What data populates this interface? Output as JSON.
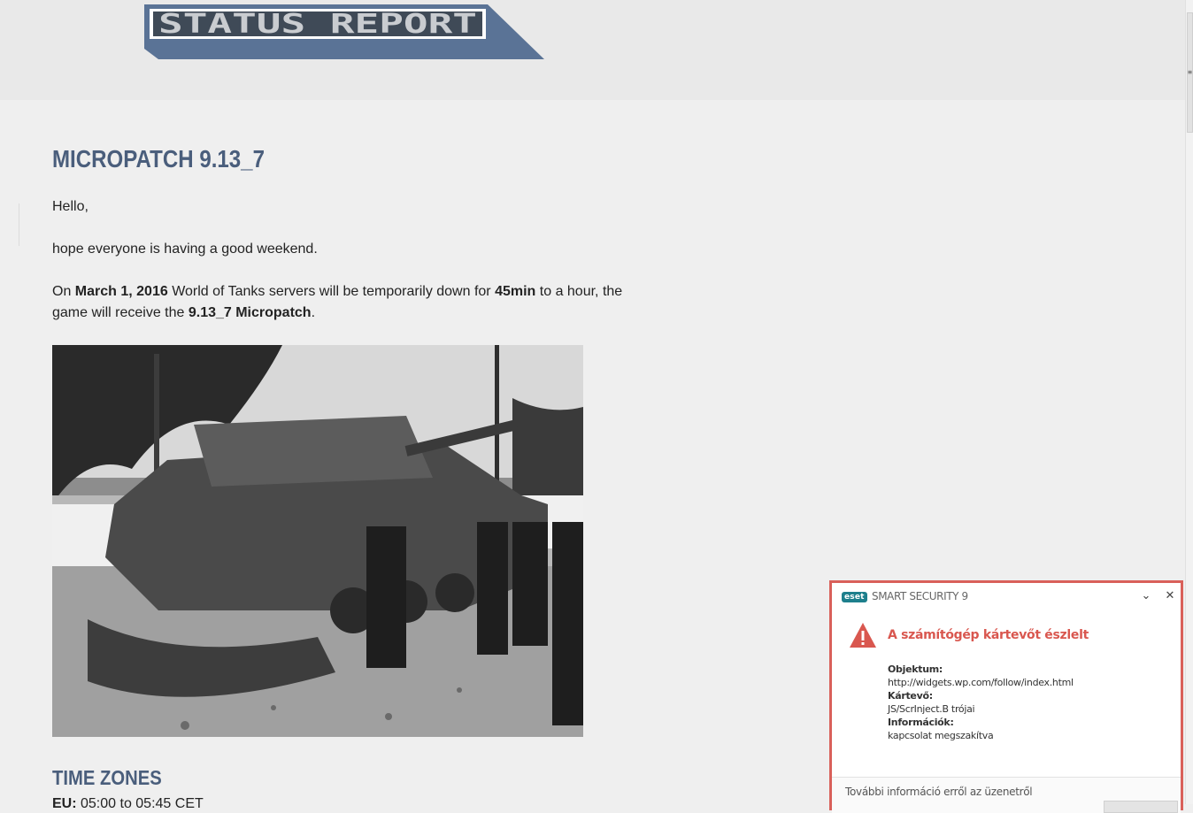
{
  "header": {
    "logo_text": "STATUS REPORT"
  },
  "article": {
    "title": "MICROPATCH 9.13_7",
    "greeting": "Hello,",
    "intro": "hope everyone is having a good weekend.",
    "body": {
      "p1": "On ",
      "date": "March 1, 2016",
      "p2": " World of Tanks servers will be temporarily down for ",
      "duration": "45min",
      "p3": " to a hour, the game will receive the ",
      "patch": "9.13_7 Micropatch",
      "p4": "."
    },
    "image_subject": "tank-photo",
    "section_title": "TIME ZONES",
    "timezone_line_label": "EU:",
    "timezone_line_value": " 05:00 to 05:45 CET"
  },
  "eset": {
    "brand": "eset",
    "product": "SMART SECURITY 9",
    "alert_title": "A számítógép kártevőt észlelt",
    "object_label": "Objektum:",
    "object_value": "http://widgets.wp.com/follow/index.html",
    "threat_label": "Kártevő:",
    "threat_value": "JS/ScrInject.B trójai",
    "info_label": "Információk:",
    "info_value": "kapcsolat megszakítva",
    "more_info": "További információ erről az üzenetről",
    "accent_color": "#d9605a"
  }
}
